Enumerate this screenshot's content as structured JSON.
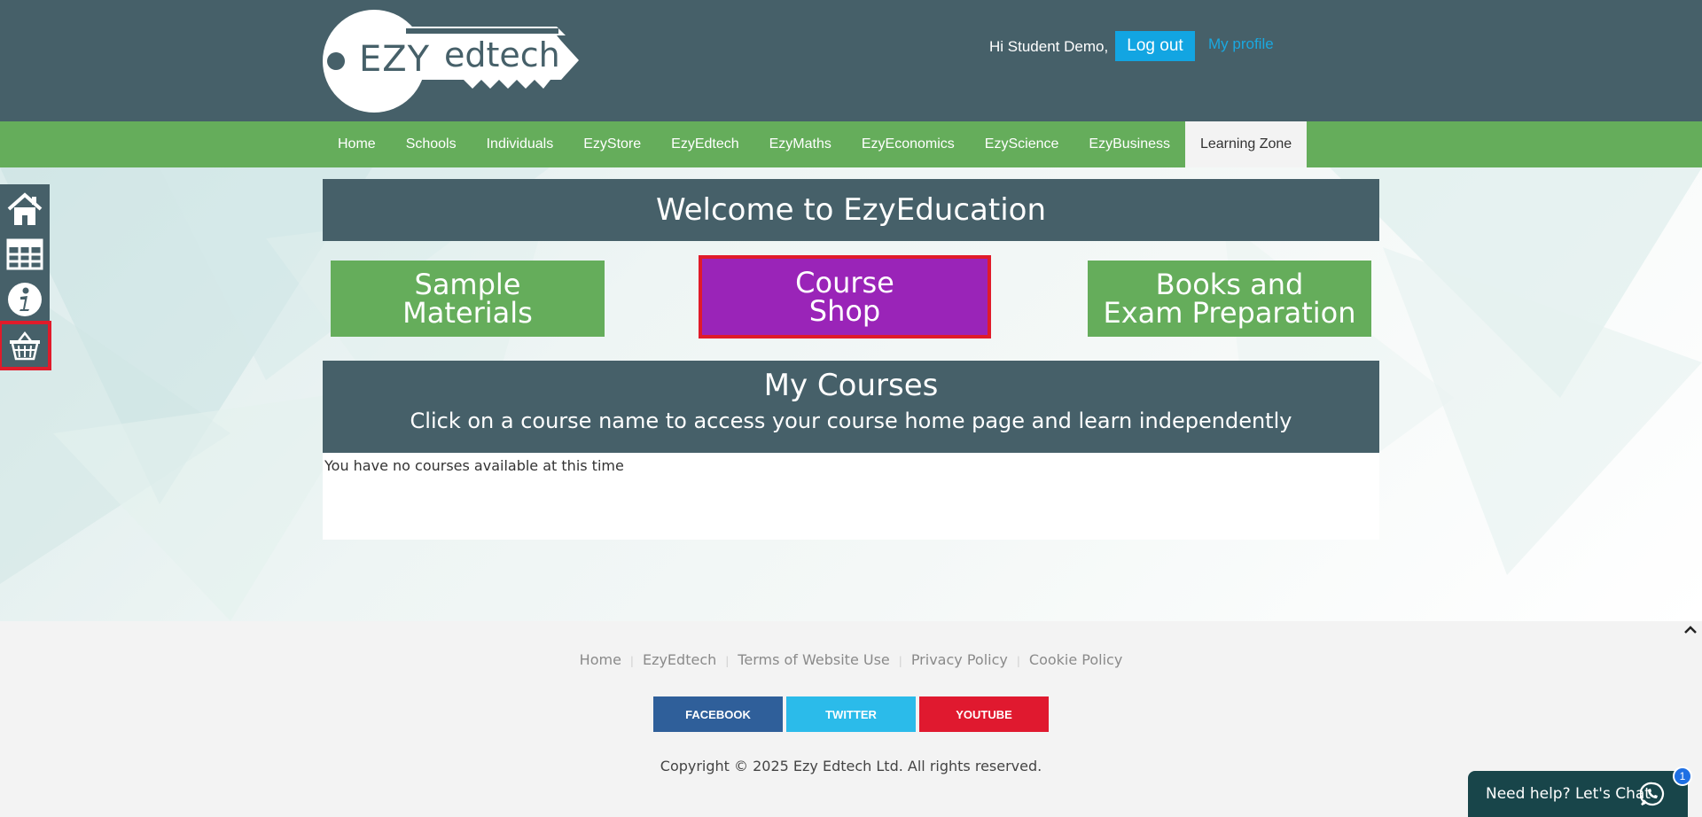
{
  "header": {
    "logo_left": "EZY",
    "logo_right": "edtech",
    "greeting": "Hi Student Demo,",
    "logout_label": "Log out",
    "profile_label": "My profile"
  },
  "nav": {
    "items": [
      "Home",
      "Schools",
      "Individuals",
      "EzyStore",
      "EzyEdtech",
      "EzyMaths",
      "EzyEconomics",
      "EzyScience",
      "EzyBusiness",
      "Learning Zone"
    ],
    "active": "Learning Zone"
  },
  "main": {
    "welcome": "Welcome to EzyEducation",
    "tiles": [
      {
        "line1": "Sample",
        "line2": "Materials"
      },
      {
        "line1": "Course",
        "line2": "Shop"
      },
      {
        "line1": "Books and",
        "line2": "Exam Preparation"
      }
    ],
    "my_courses_title": "My Courses",
    "my_courses_subtitle": "Click on a course name to access your course home page and learn independently",
    "no_courses": "You have no courses available at this time"
  },
  "sidebar": {
    "items": [
      "home-icon",
      "grid-icon",
      "info-icon",
      "basket-icon"
    ],
    "active": "basket-icon"
  },
  "footer": {
    "links": [
      "Home",
      "EzyEdtech",
      "Terms of Website Use",
      "Privacy Policy",
      "Cookie Policy"
    ],
    "social": {
      "facebook": "FACEBOOK",
      "twitter": "TWITTER",
      "youtube": "YOUTUBE"
    },
    "copyright": "Copyright © 2025 Ezy Edtech Ltd. All rights reserved."
  },
  "chat": {
    "label": "Need help? Let's Chat",
    "badge": "1"
  },
  "colors": {
    "header": "#466069",
    "nav": "#65ad5b",
    "accent_blue": "#12a5e2",
    "course_shop": "#9a24b8",
    "highlight": "#e01b2a"
  }
}
